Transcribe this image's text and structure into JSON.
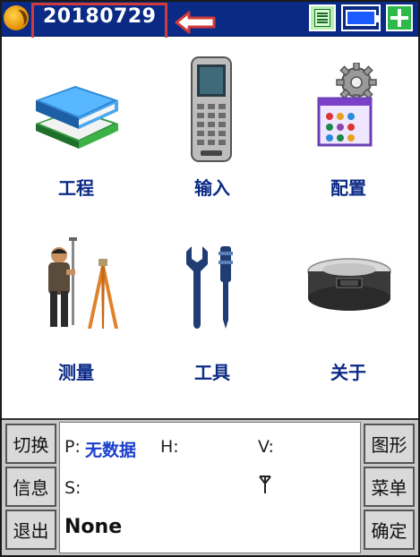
{
  "titlebar": {
    "project_name": "20180729",
    "icons": [
      "app-logo-icon",
      "notes-icon",
      "battery-icon",
      "add-icon"
    ]
  },
  "menu": {
    "items": [
      {
        "label": "工程",
        "icon": "books-icon"
      },
      {
        "label": "输入",
        "icon": "handheld-device-icon"
      },
      {
        "label": "配置",
        "icon": "settings-gear-icon"
      },
      {
        "label": "测量",
        "icon": "surveyor-tripod-icon"
      },
      {
        "label": "工具",
        "icon": "wrench-screwdriver-icon"
      },
      {
        "label": "关于",
        "icon": "gnss-receiver-icon"
      }
    ]
  },
  "bottom": {
    "left_buttons": [
      "切换",
      "信息",
      "退出"
    ],
    "right_buttons": [
      "图形",
      "菜单",
      "确定"
    ],
    "p_label": "P:",
    "p_value": "无数据",
    "h_label": "H:",
    "v_label": "V:",
    "s_label": "S:",
    "solution": "None"
  },
  "colors": {
    "titlebar": "#0b2a86",
    "highlight_box": "#d23a3a",
    "label_text": "#0b2a86",
    "p_value": "#1b3fcc"
  }
}
